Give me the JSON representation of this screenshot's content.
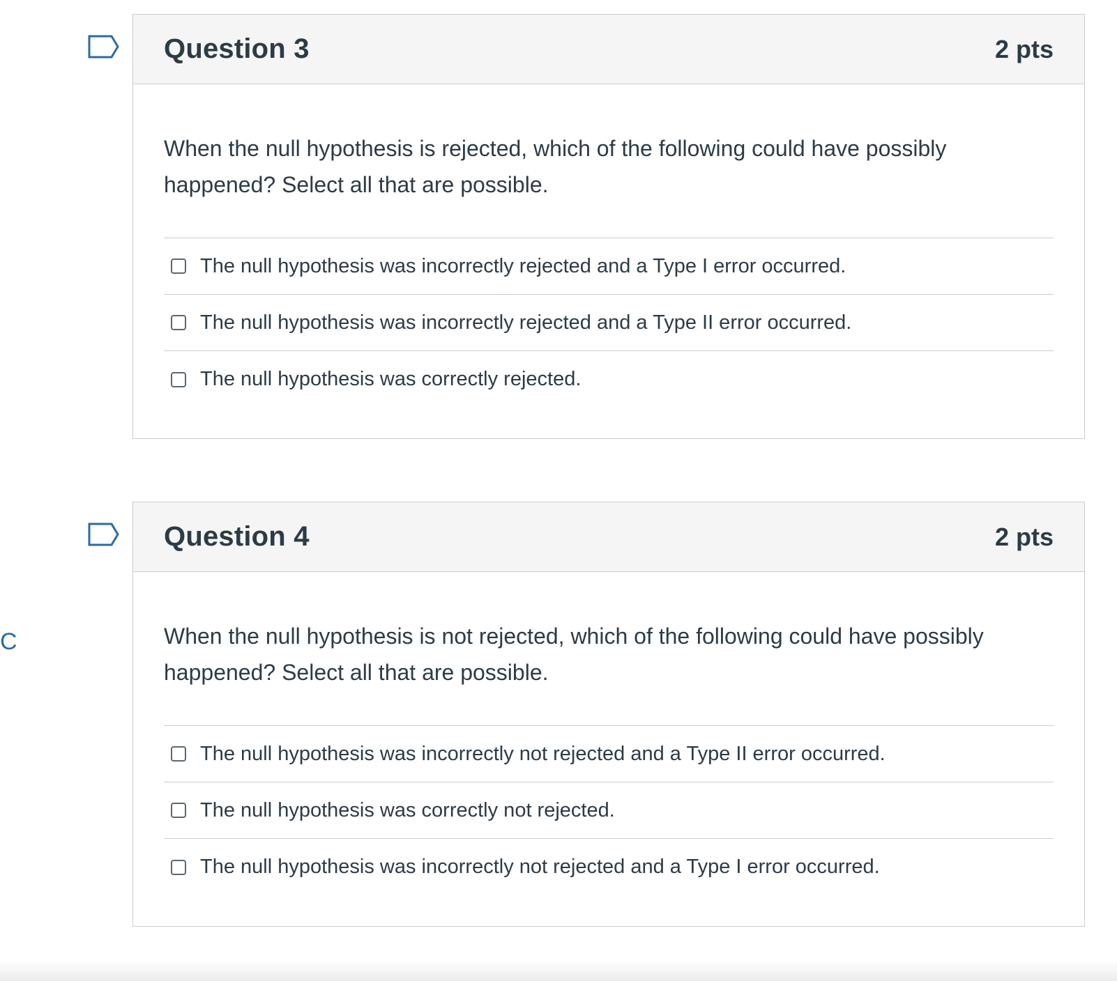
{
  "side_letter": "C",
  "questions": [
    {
      "title": "Question 3",
      "points": "2 pts",
      "text": "When the null hypothesis is rejected, which of the following could have possibly happened?  Select all that are possible.",
      "answers": [
        {
          "label": "The null hypothesis was incorrectly rejected and a Type I error occurred.",
          "checked": false
        },
        {
          "label": "The null hypothesis was incorrectly rejected and a Type II error occurred.",
          "checked": false
        },
        {
          "label": "The null hypothesis was correctly rejected.",
          "checked": false
        }
      ]
    },
    {
      "title": "Question 4",
      "points": "2 pts",
      "text": "When the null hypothesis is not rejected, which of the following could have possibly happened?  Select all that are possible.",
      "answers": [
        {
          "label": "The null hypothesis was incorrectly not rejected and a Type II error occurred.",
          "checked": false
        },
        {
          "label": "The null hypothesis was correctly not rejected.",
          "checked": false
        },
        {
          "label": "The null hypothesis was incorrectly not rejected and a Type I error occurred.",
          "checked": false
        }
      ]
    }
  ],
  "colors": {
    "text": "#2d3b45",
    "border": "#c7cdd1",
    "header_bg": "#f5f5f5",
    "flag_stroke": "#2d6aa3",
    "side_letter": "#2d6aa3"
  },
  "icons": {
    "flag": "flag-question-icon",
    "checkbox": "checkbox-icon"
  }
}
